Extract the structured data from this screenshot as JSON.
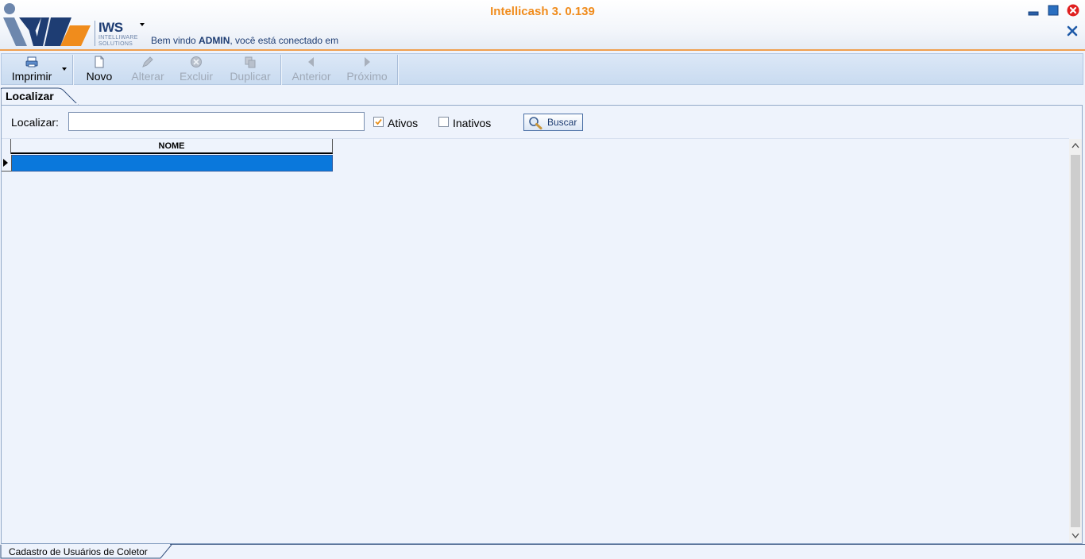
{
  "header": {
    "app_title": "Intellicash 3. 0.139",
    "logo_text": "IWS",
    "logo_sub1": "INTELLIWARE",
    "logo_sub2": "SOLUTIONS",
    "welcome_prefix": "Bem vindo ",
    "welcome_user": "ADMIN",
    "welcome_suffix": ", você está conectado em"
  },
  "toolbar": {
    "imprimir": "Imprimir",
    "novo": "Novo",
    "alterar": "Alterar",
    "excluir": "Excluir",
    "duplicar": "Duplicar",
    "anterior": "Anterior",
    "proximo": "Próximo"
  },
  "tab": {
    "label": "Localizar"
  },
  "search": {
    "label": "Localizar:",
    "value": "",
    "ativos_label": "Ativos",
    "ativos_checked": true,
    "inativos_label": "Inativos",
    "inativos_checked": false,
    "buscar_label": "Buscar"
  },
  "grid": {
    "columns": [
      "NOME"
    ],
    "rows": [
      {
        "nome": ""
      }
    ]
  },
  "status": {
    "form_title": "Cadastro de Usuários de Coletor"
  },
  "colors": {
    "accent_orange": "#f08c1c",
    "selection_blue": "#0a78dc",
    "navy": "#1e3d73"
  }
}
